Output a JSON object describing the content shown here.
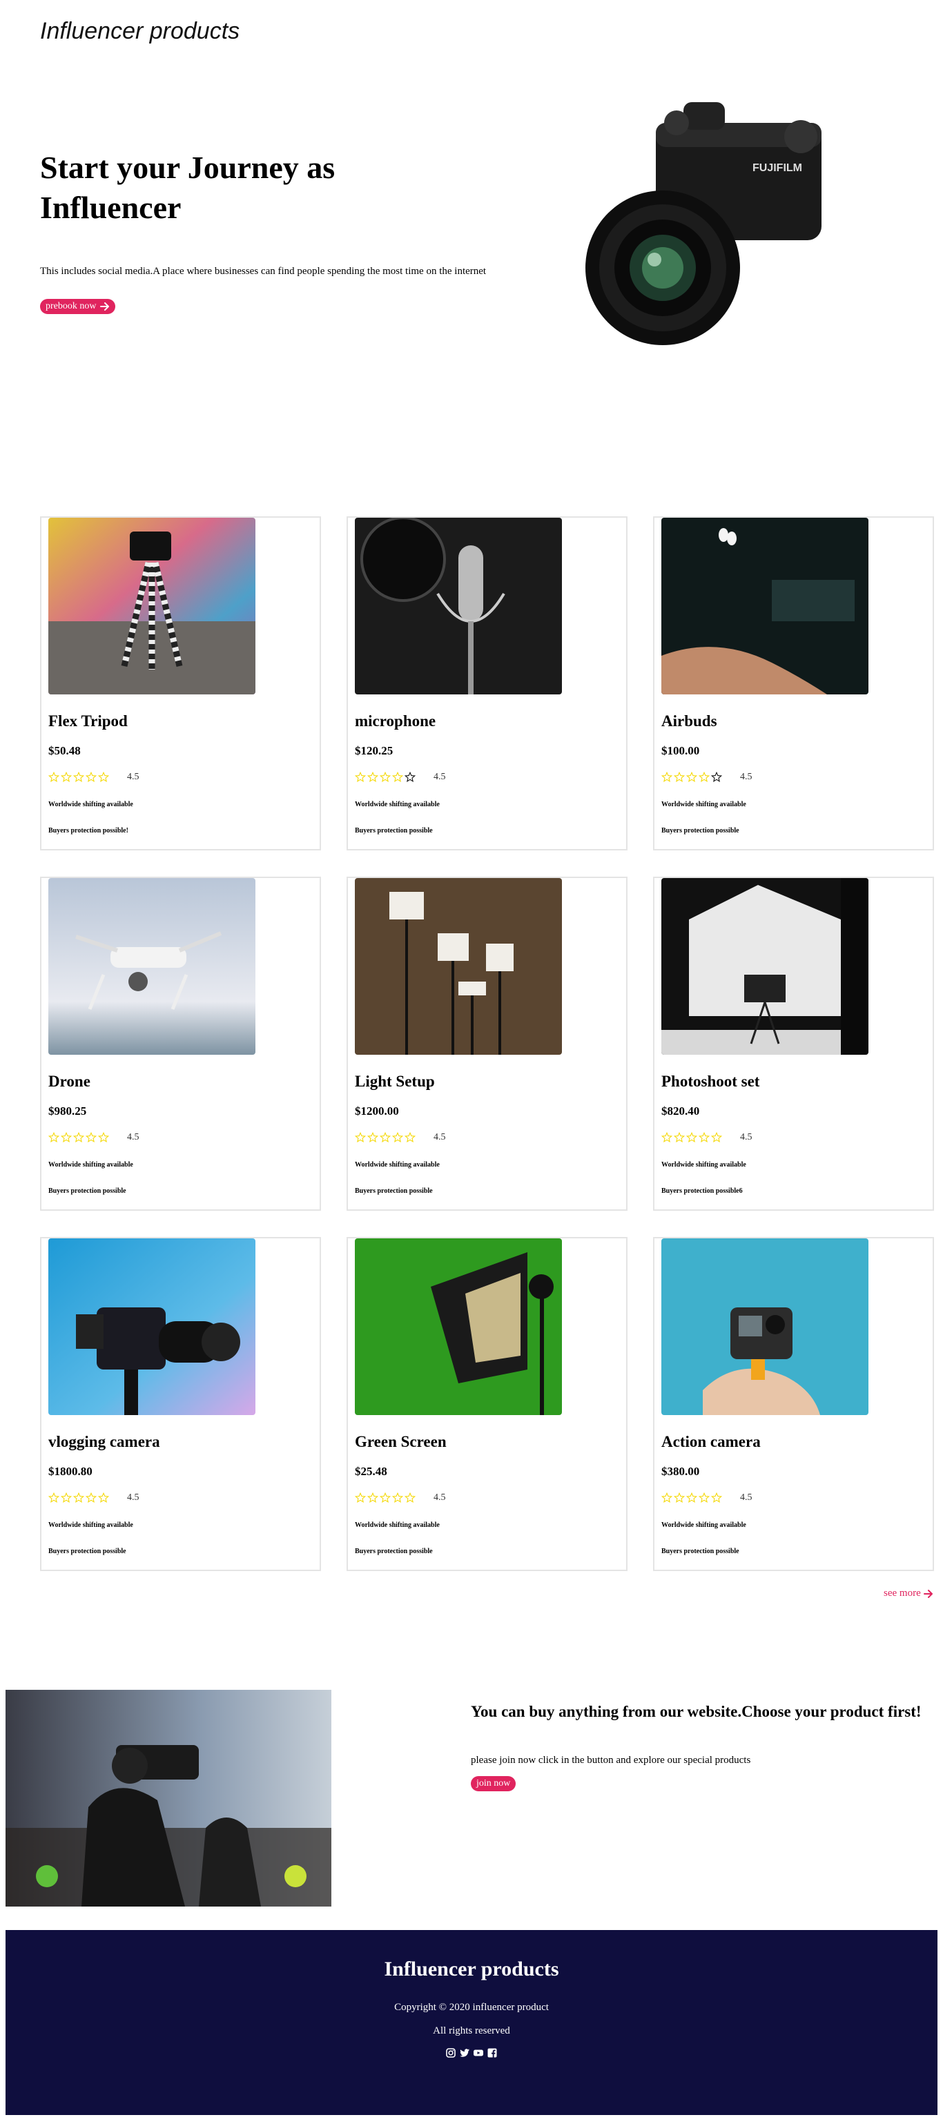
{
  "brand": "Influencer products",
  "hero": {
    "title": "Start your Journey as Influencer",
    "description": "This includes social media.A place where businesses can find people spending the most time on the internet",
    "button_label": "prebook now"
  },
  "products": [
    {
      "name": "Flex Tripod",
      "price": "$50.48",
      "rating": "4.5",
      "stars": 0,
      "shipping": "Worldwide shifting available",
      "protection": "Buyers protection possible!"
    },
    {
      "name": "microphone",
      "price": "$120.25",
      "rating": "4.5",
      "stars": 4,
      "shipping": "Worldwide shifting available",
      "protection": "Buyers protection possible"
    },
    {
      "name": "Airbuds",
      "price": "$100.00",
      "rating": "4.5",
      "stars": 4,
      "shipping": "Worldwide shifting available",
      "protection": "Buyers protection possible"
    },
    {
      "name": "Drone",
      "price": "$980.25",
      "rating": "4.5",
      "stars": 0,
      "shipping": "Worldwide shifting available",
      "protection": "Buyers protection possible"
    },
    {
      "name": "Light Setup",
      "price": "$1200.00",
      "rating": "4.5",
      "stars": 0,
      "shipping": "Worldwide shifting available",
      "protection": "Buyers protection possible"
    },
    {
      "name": "Photoshoot set",
      "price": "$820.40",
      "rating": "4.5",
      "stars": 0,
      "shipping": "Worldwide shifting available",
      "protection": "Buyers protection possible6"
    },
    {
      "name": "vlogging camera",
      "price": "$1800.80",
      "rating": "4.5",
      "stars": 0,
      "shipping": "Worldwide shifting available",
      "protection": "Buyers protection possible"
    },
    {
      "name": "Green Screen",
      "price": "$25.48",
      "rating": "4.5",
      "stars": 0,
      "shipping": "Worldwide shifting available",
      "protection": "Buyers protection possible"
    },
    {
      "name": "Action camera",
      "price": "$380.00",
      "rating": "4.5",
      "stars": 0,
      "shipping": "Worldwide shifting available",
      "protection": "Buyers protection possible"
    }
  ],
  "see_more": "see more",
  "promo": {
    "title": "You can buy anything from our website.Choose your product first!",
    "description": "please join now click in the button and explore our special products",
    "button_label": "join now"
  },
  "footer": {
    "title": "Influencer products",
    "copyright": "Copyright © 2020 influencer product",
    "rights": "All rights reserved",
    "socials": [
      "instagram-icon",
      "twitter-icon",
      "youtube-icon",
      "facebook-icon"
    ]
  },
  "colors": {
    "accent": "#e0245e",
    "footer_bg": "#0f0e3e",
    "star": "#f5d90a"
  }
}
